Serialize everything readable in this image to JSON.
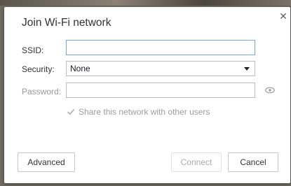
{
  "dialog": {
    "title": "Join Wi-Fi network",
    "close_icon": "close-icon"
  },
  "fields": {
    "ssid_label": "SSID:",
    "ssid_value": "",
    "security_label": "Security:",
    "security_value": "None",
    "password_label": "Password:",
    "password_value": "",
    "password_toggle_icon": "eye-icon"
  },
  "share": {
    "checked": true,
    "label": "Share this network with other users"
  },
  "buttons": {
    "advanced": "Advanced",
    "connect": "Connect",
    "cancel": "Cancel"
  },
  "colors": {
    "focus_border": "#7aa6d8",
    "disabled_text": "#aaaaaa"
  }
}
